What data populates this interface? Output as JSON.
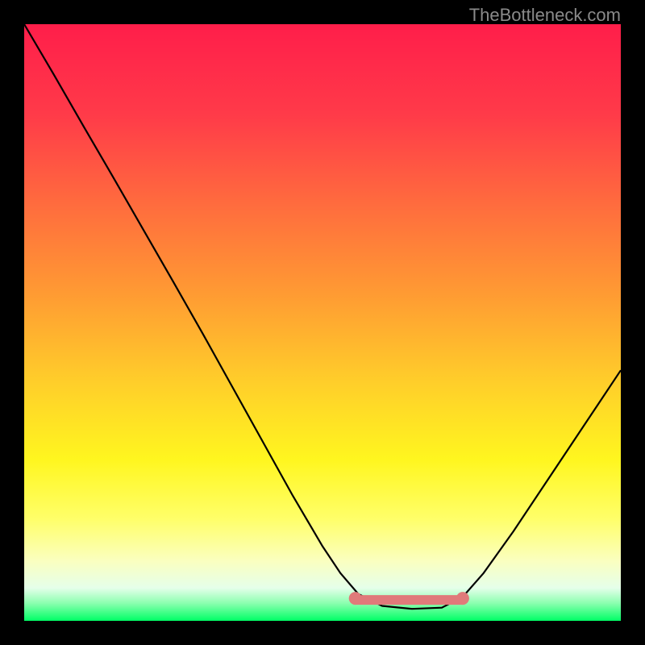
{
  "watermark": "TheBottleneck.com",
  "gradient": {
    "stops": [
      {
        "offset": 0.0,
        "color": "#ff1e4a"
      },
      {
        "offset": 0.15,
        "color": "#ff3a49"
      },
      {
        "offset": 0.3,
        "color": "#ff6b3e"
      },
      {
        "offset": 0.45,
        "color": "#ff9a33"
      },
      {
        "offset": 0.6,
        "color": "#ffce2a"
      },
      {
        "offset": 0.73,
        "color": "#fff61f"
      },
      {
        "offset": 0.83,
        "color": "#ffff6a"
      },
      {
        "offset": 0.9,
        "color": "#faffc0"
      },
      {
        "offset": 0.945,
        "color": "#e5ffea"
      },
      {
        "offset": 0.97,
        "color": "#8dffb0"
      },
      {
        "offset": 1.0,
        "color": "#00ff66"
      }
    ]
  },
  "optimal_marker": {
    "color": "#e07a7a",
    "y": 0.965,
    "x_start": 0.555,
    "x_end": 0.735,
    "thickness": 12,
    "dot_radius": 8
  },
  "chart_data": {
    "type": "line",
    "title": "",
    "xlabel": "",
    "ylabel": "",
    "xlim": [
      0,
      1
    ],
    "ylim": [
      0,
      1
    ],
    "note": "Axes are unlabeled; values are normalized screen-fractions read from pixel positions. Higher y means lower on screen (valley shape).",
    "series": [
      {
        "name": "curve",
        "x": [
          0.0,
          0.05,
          0.1,
          0.15,
          0.2,
          0.25,
          0.3,
          0.35,
          0.4,
          0.45,
          0.5,
          0.53,
          0.56,
          0.6,
          0.65,
          0.7,
          0.735,
          0.77,
          0.82,
          0.87,
          0.92,
          0.96,
          1.0
        ],
        "y": [
          0.0,
          0.085,
          0.172,
          0.258,
          0.345,
          0.432,
          0.52,
          0.61,
          0.7,
          0.79,
          0.875,
          0.92,
          0.955,
          0.975,
          0.98,
          0.978,
          0.96,
          0.92,
          0.85,
          0.775,
          0.7,
          0.64,
          0.58
        ]
      }
    ],
    "optimal_range_x": [
      0.555,
      0.735
    ]
  }
}
